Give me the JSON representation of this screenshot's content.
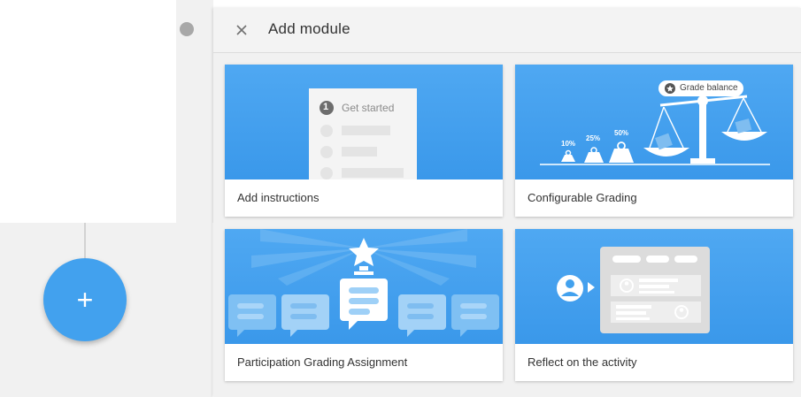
{
  "panel": {
    "title": "Add module",
    "close_icon": "close-icon"
  },
  "fab": {
    "icon": "plus-icon",
    "glyph": "+"
  },
  "cards": [
    {
      "label": "Add instructions",
      "illustration": {
        "step_number": "1",
        "step_text": "Get started"
      }
    },
    {
      "label": "Configurable Grading",
      "illustration": {
        "badge_text": "Grade balance",
        "weights": [
          "10%",
          "25%",
          "50%"
        ]
      }
    },
    {
      "label": "Participation Grading Assignment"
    },
    {
      "label": "Reflect on the activity"
    }
  ],
  "colors": {
    "accent": "#42a1ee",
    "card_illustration": "#3a98ea",
    "panel_bg": "#f1f1f1"
  }
}
